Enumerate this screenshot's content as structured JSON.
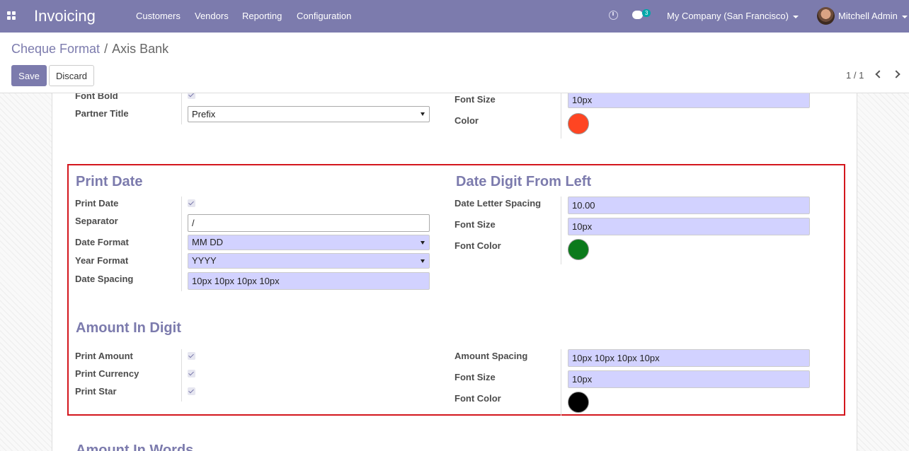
{
  "navbar": {
    "app_name": "Invoicing",
    "menu": [
      "Customers",
      "Vendors",
      "Reporting",
      "Configuration"
    ],
    "chat_count": "3",
    "company": "My Company (San Francisco)",
    "user": "Mitchell Admin"
  },
  "breadcrumb": {
    "parent": "Cheque Format",
    "separator": "/",
    "current": "Axis Bank"
  },
  "buttons": {
    "save": "Save",
    "discard": "Discard"
  },
  "pager": "1 / 1",
  "top_section": {
    "font_bold_label": "Font Bold",
    "font_bold": true,
    "partner_title_label": "Partner Title",
    "partner_title": "Prefix",
    "font_size_label": "Font Size",
    "font_size": "10px",
    "color_label": "Color",
    "color": "#ff4522"
  },
  "print_date": {
    "title": "Print Date",
    "print_date_label": "Print Date",
    "print_date": true,
    "separator_label": "Separator",
    "separator": "/",
    "date_format_label": "Date Format",
    "date_format": "MM DD",
    "year_format_label": "Year Format",
    "year_format": "YYYY",
    "date_spacing_label": "Date Spacing",
    "date_spacing": "10px 10px 10px 10px"
  },
  "date_digit": {
    "title": "Date Digit From Left",
    "letter_spacing_label": "Date Letter Spacing",
    "letter_spacing": "10.00",
    "font_size_label": "Font Size",
    "font_size": "10px",
    "font_color_label": "Font Color",
    "font_color": "#0b7a1b"
  },
  "amount_digit": {
    "title": "Amount In Digit",
    "print_amount_label": "Print Amount",
    "print_currency_label": "Print Currency",
    "print_star_label": "Print Star",
    "print_amount": true,
    "print_currency": true,
    "print_star": true,
    "amount_spacing_label": "Amount Spacing",
    "amount_spacing": "10px 10px 10px 10px",
    "font_size_label": "Font Size",
    "font_size": "10px",
    "font_color_label": "Font Color",
    "font_color": "#000000"
  },
  "amount_words": {
    "title": "Amount In Words"
  },
  "colors": {
    "brand": "#7c7bad",
    "highlight_border": "#d3161d",
    "field_bg": "#d2d2ff"
  }
}
